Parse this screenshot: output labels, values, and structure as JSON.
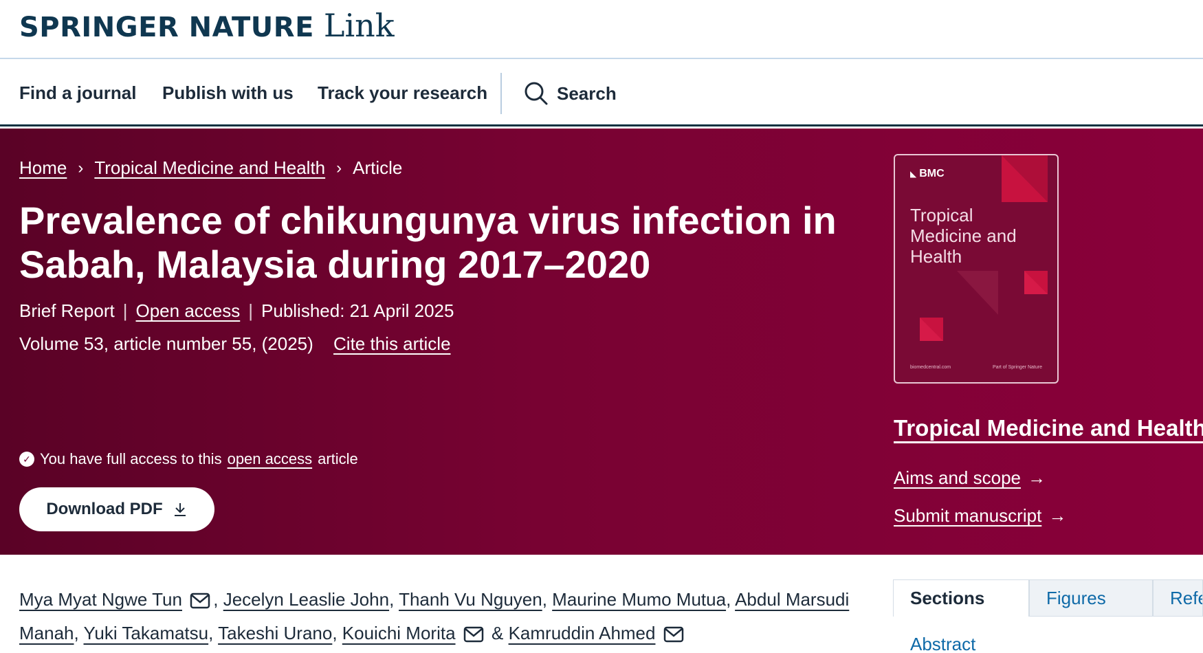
{
  "header": {
    "brand": "SPRINGER NATURE",
    "product": "Link"
  },
  "nav": {
    "items": [
      "Find a journal",
      "Publish with us",
      "Track your research"
    ],
    "search_label": "Search"
  },
  "breadcrumb": {
    "home": "Home",
    "journal": "Tropical Medicine and Health",
    "current": "Article"
  },
  "article": {
    "title": "Prevalence of chikungunya virus infection in Sabah, Malaysia during 2017–2020",
    "type": "Brief Report",
    "access": "Open access",
    "published": "Published: 21 April 2025",
    "volume": "Volume 53, article number 55, (2025)",
    "cite": "Cite this article",
    "access_notice_prefix": "You have full access to this",
    "access_notice_link": "open access",
    "access_notice_suffix": "article",
    "download_label": "Download PDF"
  },
  "cover": {
    "publisher": "BMC",
    "journal_name": "Tropical Medicine and Health",
    "footer_left": "biomedcentral.com",
    "footer_right": "Part of Springer Nature"
  },
  "sidebar": {
    "journal_title": "Tropical Medicine and Health",
    "aims": "Aims and scope",
    "submit": "Submit manuscript"
  },
  "authors": [
    {
      "name": "Mya Myat Ngwe Tun",
      "mail": true
    },
    {
      "name": "Jecelyn Leaslie John",
      "mail": false
    },
    {
      "name": "Thanh Vu Nguyen",
      "mail": false
    },
    {
      "name": "Maurine Mumo Mutua",
      "mail": false
    },
    {
      "name": "Abdul Marsudi Manah",
      "mail": false
    },
    {
      "name": "Yuki Takamatsu",
      "mail": false
    },
    {
      "name": "Takeshi Urano",
      "mail": false
    },
    {
      "name": "Kouichi Morita",
      "mail": true
    },
    {
      "name": "Kamruddin Ahmed",
      "mail": true
    }
  ],
  "tabs": [
    "Sections",
    "Figures",
    "References"
  ],
  "sections_first": "Abstract",
  "colors": {
    "hero": "#780232",
    "brand_navy": "#0f3750",
    "link_blue": "#0f6aa8"
  }
}
